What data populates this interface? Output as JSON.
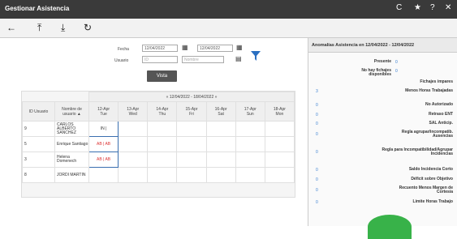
{
  "window": {
    "title": "Gestionar Asistencia",
    "controls": [
      "C",
      "★",
      "?",
      "✕"
    ]
  },
  "toolbar": {
    "icons": [
      "back-arrow-icon",
      "upload-icon",
      "download-icon",
      "refresh-icon"
    ]
  },
  "filters": {
    "fecha_label": "Fecha",
    "fecha_from": "12/04/2022",
    "fecha_to": "12/04/2022",
    "usuario_label": "Usuario",
    "id_placeholder": "ID",
    "nombre_placeholder": "Nombre",
    "vista_button": "Vista"
  },
  "grid": {
    "range": "« 12/04/2022 - 18/04/2022 »",
    "columns": {
      "id": "ID Usuario",
      "name": "Nombre de usuario ▲"
    },
    "days": [
      {
        "date": "12-Apr",
        "day": "Tue"
      },
      {
        "date": "13-Apr",
        "day": "Wed"
      },
      {
        "date": "14-Apr",
        "day": "Thu"
      },
      {
        "date": "15-Apr",
        "day": "Fri"
      },
      {
        "date": "16-Apr",
        "day": "Sat"
      },
      {
        "date": "17-Apr",
        "day": "Sun"
      },
      {
        "date": "18-Apr",
        "day": "Mon"
      }
    ],
    "rows": [
      {
        "id": "9",
        "name": "CARLOS ALBERTO SANCHEZ",
        "cell": "IN |"
      },
      {
        "id": "5",
        "name": "Enrique Santiago",
        "cell": "AB | AB"
      },
      {
        "id": "3",
        "name": "Helena Domenech",
        "cell": "AB | AB"
      },
      {
        "id": "8",
        "name": "JORDI MARTIN",
        "cell": ""
      }
    ]
  },
  "anomalies": {
    "header": "Anomalías Asistencia en 12/04/2022 - 12/04/2022",
    "items": [
      {
        "label": "Presente",
        "value": "0"
      },
      {
        "label": "No hay fichajes disponibles",
        "value": "0"
      },
      {
        "label": "Fichajes impares",
        "value": ""
      },
      {
        "label": "Menos Horas Trabajadas",
        "value": "3"
      },
      {
        "label": "No Autorizado",
        "value": "0"
      },
      {
        "label": "Retraso ENT",
        "value": "0"
      },
      {
        "label": "SAL Anticip.",
        "value": "0"
      },
      {
        "label": "Regla agrupar/incompatib. Ausencias",
        "value": "0"
      },
      {
        "label": "Regla para Incompatibilidad/Agrupar Incidencias",
        "value": "0"
      },
      {
        "label": "Saldo Incidencia Corto",
        "value": "0"
      },
      {
        "label": "Déficit sobre Objetivo",
        "value": "0"
      },
      {
        "label": "Recuento Menos Margen de Cortesía",
        "value": "0"
      },
      {
        "label": "Límite Horas Trabajo",
        "value": "0"
      }
    ]
  }
}
